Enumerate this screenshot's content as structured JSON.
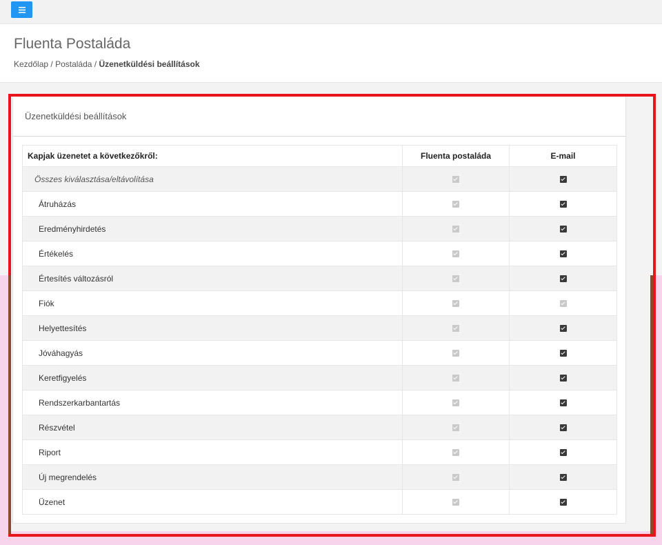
{
  "header": {
    "menu_icon": "hamburger-icon",
    "title": "Fluenta Postaláda",
    "breadcrumb": [
      {
        "label": "Kezdőlap"
      },
      {
        "label": "Postaláda"
      },
      {
        "label": "Üzenetküldési beállítások"
      }
    ],
    "separator": " / "
  },
  "panel": {
    "title": "Üzenetküldési beállítások",
    "table": {
      "headers": {
        "name": "Kapjak üzenetet a következőkről:",
        "mailbox": "Fluenta postaláda",
        "email": "E-mail"
      },
      "rows": [
        {
          "label": "Összes kiválasztása/eltávolítása",
          "mailbox": "disabled-checked",
          "email": "checked"
        },
        {
          "label": "Átruházás",
          "mailbox": "disabled-checked",
          "email": "checked"
        },
        {
          "label": "Eredményhirdetés",
          "mailbox": "disabled-checked",
          "email": "checked"
        },
        {
          "label": "Értékelés",
          "mailbox": "disabled-checked",
          "email": "checked"
        },
        {
          "label": "Értesítés változásról",
          "mailbox": "disabled-checked",
          "email": "checked"
        },
        {
          "label": "Fiók",
          "mailbox": "disabled-checked",
          "email": "disabled-checked"
        },
        {
          "label": "Helyettesítés",
          "mailbox": "disabled-checked",
          "email": "checked"
        },
        {
          "label": "Jóváhagyás",
          "mailbox": "disabled-checked",
          "email": "checked"
        },
        {
          "label": "Keretfigyelés",
          "mailbox": "disabled-checked",
          "email": "checked"
        },
        {
          "label": "Rendszerkarbantartás",
          "mailbox": "disabled-checked",
          "email": "checked"
        },
        {
          "label": "Részvétel",
          "mailbox": "disabled-checked",
          "email": "checked"
        },
        {
          "label": "Riport",
          "mailbox": "disabled-checked",
          "email": "checked"
        },
        {
          "label": "Új megrendelés",
          "mailbox": "disabled-checked",
          "email": "checked"
        },
        {
          "label": "Üzenet",
          "mailbox": "disabled-checked",
          "email": "checked"
        }
      ]
    }
  },
  "colors": {
    "accent": "#2196f3",
    "highlight_frame": "#e8161c",
    "checked": "#3a3a3a",
    "disabled": "#c9c9c9"
  }
}
